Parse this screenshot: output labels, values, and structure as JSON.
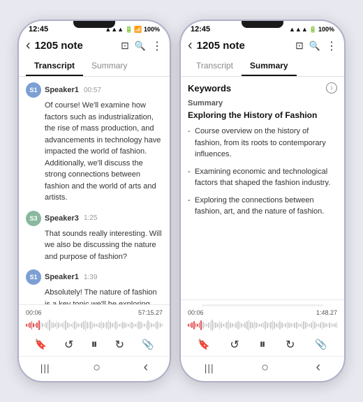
{
  "phone_left": {
    "status": {
      "time": "12:45",
      "icons": "📶 100%"
    },
    "header": {
      "back": "‹",
      "title": "1205 note",
      "icon1": "⊡",
      "icon2": "🔍",
      "icon3": "⋮"
    },
    "tabs": {
      "transcript": "Transcript",
      "summary": "Summary",
      "active": "transcript"
    },
    "entries": [
      {
        "speaker": "Speaker1",
        "time": "00:57",
        "text": "Of course! We'll examine how factors such as industrialization, the rise of mass production, and advancements in technology have impacted the world of fashion. Additionally, we'll discuss the strong connections between fashion and the world of arts and artists."
      },
      {
        "speaker": "Speaker3",
        "time": "1:25",
        "text": "That sounds really interesting. Will we also be discussing the nature and purpose of fashion?"
      },
      {
        "speaker": "Speaker1",
        "time": "1:39",
        "text": "Absolutely! The nature of fashion is a key topic we'll be exploring."
      }
    ],
    "player": {
      "current_time": "00:06",
      "total_time": "57:15.27"
    },
    "controls": {
      "bookmark": "🔖",
      "rewind": "↺",
      "pause": "⏸",
      "forward": "↻",
      "save": "🔖"
    },
    "nav": {
      "menu": "|||",
      "home": "○",
      "back": "‹"
    }
  },
  "phone_right": {
    "status": {
      "time": "12:45",
      "icons": "📶 100%"
    },
    "header": {
      "back": "‹",
      "title": "1205 note",
      "icon1": "⊡",
      "icon2": "🔍",
      "icon3": "⋮"
    },
    "tabs": {
      "transcript": "Transcript",
      "summary": "Summary",
      "active": "summary"
    },
    "keywords_title": "Keywords",
    "summary_section": {
      "label": "Summary",
      "subtitle": "Exploring the History of Fashion",
      "bullets": [
        "Course overview on the history of fashion, from its roots to contemporary influences.",
        "Examining economic and technological factors that shaped the fashion industry.",
        "Exploring the connections between fashion, art, and the nature of fashion."
      ]
    },
    "player": {
      "current_time": "00:06",
      "total_time": "1:48.27"
    },
    "controls": {
      "bookmark": "🔖",
      "rewind": "↺",
      "pause": "⏸",
      "forward": "↻",
      "save": "🔖"
    },
    "nav": {
      "menu": "|||",
      "home": "○",
      "back": "‹"
    }
  }
}
